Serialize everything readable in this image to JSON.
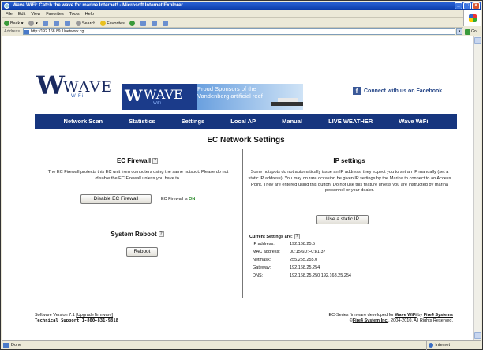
{
  "browser": {
    "title": "Wave WiFi: Catch the wave for marine Internet! - Microsoft Internet Explorer",
    "menu": [
      "File",
      "Edit",
      "View",
      "Favorites",
      "Tools",
      "Help"
    ],
    "toolbar": {
      "back": "Back",
      "search": "Search",
      "favorites": "Favorites"
    },
    "address_label": "Address",
    "address": "http://192.168.89.1/network.cgi",
    "go": "Go",
    "status": "Done",
    "zone": "Internet"
  },
  "header": {
    "logo_text": "WAVE",
    "logo_sub": "WiFi",
    "sponsor_logo_text": "WAVE",
    "sponsor_logo_sub": "WiFi",
    "sponsor_text": "Proud Sponsors of the Vandenberg artificial reef",
    "facebook": "Connect with us on Facebook"
  },
  "nav": [
    "Network Scan",
    "Statistics",
    "Settings",
    "Local AP",
    "Manual",
    "LIVE WEATHER",
    "Wave WiFi"
  ],
  "page_title": "EC Network Settings",
  "firewall": {
    "title": "EC Firewall",
    "help": "?",
    "description": "The EC Firewall protects this EC unit from computers using the same hotspot. Please do not disable the EC Firewall unless you have to.",
    "button": "Disable EC Firewall",
    "status_label": "EC Firewall is",
    "status_value": "ON"
  },
  "reboot": {
    "title": "System Reboot",
    "help": "?",
    "button": "Reboot"
  },
  "ip": {
    "title": "IP settings",
    "description": "Some hotspots do not automatically issue an IP address, they expect you to set an IP manually (set a static IP address). You may on rare occasion be given IP settings by the Marina to connect to an Access Point. They are entered using this button. Do not use this feature unless you are instructed by marina personnel or your dealer.",
    "button": "Use a static IP",
    "current_title": "Current Settings are:",
    "help": "?",
    "rows": [
      {
        "k": "IP address:",
        "v": "192.168.25.5"
      },
      {
        "k": "MAC address:",
        "v": "00:15:6D:F0:81:37"
      },
      {
        "k": "Netmask:",
        "v": "255.255.255.0"
      },
      {
        "k": "Gateway:",
        "v": "192.168.25.254"
      },
      {
        "k": "DNS:",
        "v": "192.168.25.250 192.168.25.254"
      }
    ]
  },
  "footer": {
    "version": "Software Version 7.1",
    "upgrade": "[Upgrade firmware]",
    "support": "Technical Support 1-800-831-9818",
    "fw_line_prefix": "EC-Series firmware developed for",
    "fw_brand": "Wave WiFi",
    "fw_by": "by",
    "fw_company": "Fire4 Systems",
    "copyright_prefix": "©",
    "copyright_company": "Fire4 System Inc.",
    "copyright_suffix": ", 2004-2010. All Rights Reserved."
  }
}
